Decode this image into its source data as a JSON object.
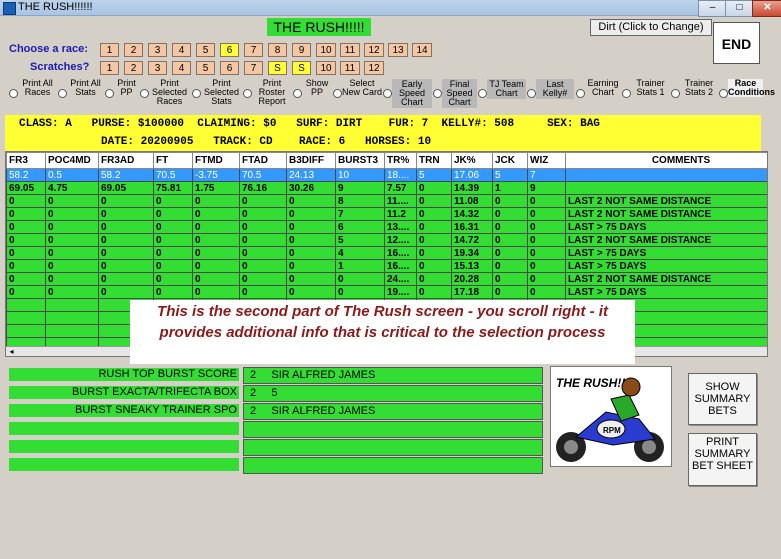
{
  "window": {
    "title": "THE RUSH!!!!!!"
  },
  "app_title": "THE RUSH!!!!!",
  "surface_button": "Dirt (Click to Change)",
  "end_button": "END",
  "choose_label": "Choose  a race:",
  "scratches_label": "Scratches?",
  "races": [
    "1",
    "2",
    "3",
    "4",
    "5",
    "6",
    "7",
    "8",
    "9",
    "10",
    "11",
    "12",
    "13",
    "14"
  ],
  "selected_race": "6",
  "scratches": [
    "1",
    "2",
    "3",
    "4",
    "5",
    "6",
    "7",
    "S",
    "S",
    "10",
    "11",
    "12"
  ],
  "options": [
    {
      "label": "Print All Races"
    },
    {
      "label": "Print All Stats"
    },
    {
      "label": "Print PP"
    },
    {
      "label": "Print Selected Races"
    },
    {
      "label": "Print Selected Stats"
    },
    {
      "label": "Print Roster Report"
    },
    {
      "label": "Show PP"
    },
    {
      "label": "Select New Card"
    },
    {
      "label": "Early Speed Chart"
    },
    {
      "label": "Final Speed Chart"
    },
    {
      "label": "TJ Team Chart"
    },
    {
      "label": "Last Kelly#"
    },
    {
      "label": "Earning Chart"
    },
    {
      "label": "Trainer Stats 1"
    },
    {
      "label": "Trainer Stats 2"
    },
    {
      "label": "Race Conditions"
    }
  ],
  "race_info": {
    "line1": "CLASS: A   PURSE: $100000  CLAIMING: $0   SURF: DIRT    FUR: 7  KELLY#: 508     SEX: BAG",
    "line2": "DATE: 20200905   TRACK: CD    RACE: 6   HORSES: 10"
  },
  "grid": {
    "columns": [
      "FR3",
      "POC4MD",
      "FR3AD",
      "FT",
      "FTMD",
      "FTAD",
      "B3DIFF",
      "BURST3",
      "TR%",
      "TRN",
      "JK%",
      "JCK",
      "WIZ",
      "COMMENTS"
    ],
    "rows": [
      [
        "58.2",
        "0.5",
        "58.2",
        "70.5",
        "-3.75",
        "70.5",
        "24.13",
        "10",
        "18....",
        "5",
        "17.06",
        "5",
        "7",
        ""
      ],
      [
        "69.05",
        "4.75",
        "69.05",
        "75.81",
        "1.75",
        "76.16",
        "30.26",
        "9",
        "7.57",
        "0",
        "14.39",
        "1",
        "9",
        ""
      ],
      [
        "0",
        "0",
        "0",
        "0",
        "0",
        "0",
        "0",
        "8",
        "11....",
        "0",
        "11.08",
        "0",
        "0",
        "LAST 2 NOT SAME DISTANCE"
      ],
      [
        "0",
        "0",
        "0",
        "0",
        "0",
        "0",
        "0",
        "7",
        "11.2",
        "0",
        "14.32",
        "0",
        "0",
        "LAST 2 NOT SAME DISTANCE"
      ],
      [
        "0",
        "0",
        "0",
        "0",
        "0",
        "0",
        "0",
        "6",
        "13....",
        "0",
        "16.31",
        "0",
        "0",
        "LAST > 75 DAYS"
      ],
      [
        "0",
        "0",
        "0",
        "0",
        "0",
        "0",
        "0",
        "5",
        "12....",
        "0",
        "14.72",
        "0",
        "0",
        "LAST 2 NOT SAME DISTANCE"
      ],
      [
        "0",
        "0",
        "0",
        "0",
        "0",
        "0",
        "0",
        "4",
        "16....",
        "0",
        "19.34",
        "0",
        "0",
        "LAST > 75 DAYS"
      ],
      [
        "0",
        "0",
        "0",
        "0",
        "0",
        "0",
        "0",
        "1",
        "16....",
        "0",
        "15.13",
        "0",
        "0",
        "LAST > 75 DAYS"
      ],
      [
        "0",
        "0",
        "0",
        "0",
        "0",
        "0",
        "0",
        "0",
        "24....",
        "0",
        "20.28",
        "0",
        "0",
        "LAST 2 NOT SAME DISTANCE"
      ],
      [
        "0",
        "0",
        "0",
        "0",
        "0",
        "0",
        "0",
        "0",
        "19....",
        "0",
        "17.18",
        "0",
        "0",
        "LAST > 75 DAYS"
      ]
    ]
  },
  "annotation": "This is the second part of The Rush screen - you scroll right - it provides additional info that is critical to the selection process",
  "bottom": {
    "labels": [
      "RUSH TOP BURST SCORE",
      "BURST EXACTA/TRIFECTA BOX",
      "BURST SNEAKY TRAINER SPO",
      "",
      "",
      ""
    ],
    "values": [
      "2     SIR ALFRED JAMES",
      "2     5",
      "2     SIR ALFRED JAMES",
      "",
      "",
      ""
    ]
  },
  "logo_text": "THE RUSH!!",
  "logo_plate": "RPM",
  "show_summary": "SHOW SUMMARY BETS",
  "print_summary": "PRINT SUMMARY BET SHEET",
  "colors": {
    "green": "#33dd33",
    "yellow": "#ffff33",
    "selection": "#3399ff",
    "note_text": "#8b1a1a"
  }
}
